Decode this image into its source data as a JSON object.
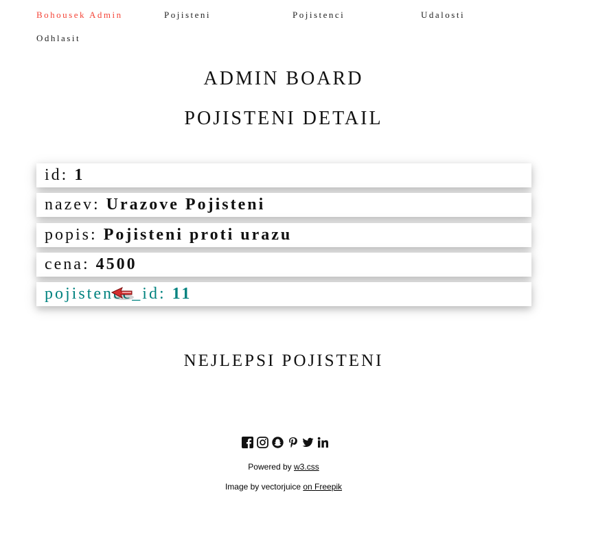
{
  "nav": {
    "brand": "Bohousek Admin",
    "items": [
      "Pojisteni",
      "Pojistenci",
      "Udalosti"
    ],
    "logout": "Odhlasit"
  },
  "page": {
    "title": "ADMIN BOARD",
    "subtitle": "POJISTENI DETAIL",
    "section_title": "NEJLEPSI POJISTENI"
  },
  "detail": [
    {
      "label": "id:",
      "value": "1"
    },
    {
      "label": "nazev:",
      "value": "Urazove Pojisteni"
    },
    {
      "label": "popis:",
      "value": "Pojisteni proti urazu"
    },
    {
      "label": "cena:",
      "value": "4500"
    },
    {
      "label": "pojistenec_id:",
      "value": "11"
    }
  ],
  "footer": {
    "social_icons": [
      "facebook-icon",
      "instagram-icon",
      "snapchat-icon",
      "pinterest-icon",
      "twitter-icon",
      "linkedin-icon"
    ],
    "powered_prefix": "Powered by",
    "powered_link": "w3.css",
    "image_prefix": "Image by vectorjuice",
    "image_link": "on Freepik"
  },
  "colors": {
    "brand": "#f44336",
    "link_teal": "#00827f"
  }
}
